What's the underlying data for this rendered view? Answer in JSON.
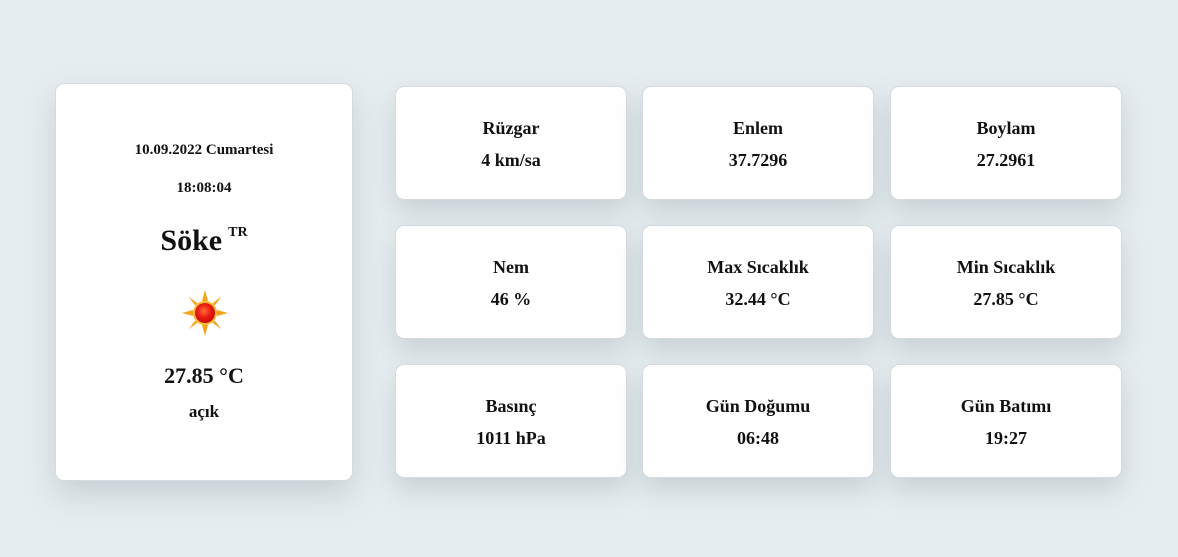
{
  "current": {
    "date": "10.09.2022 Cumartesi",
    "time": "18:08:04",
    "city": "Söke",
    "country": "TR",
    "icon": "sun-icon",
    "temperature": "27.85 °C",
    "description": "açık"
  },
  "details": [
    {
      "label": "Rüzgar",
      "value": "4 km/sa"
    },
    {
      "label": "Enlem",
      "value": "37.7296"
    },
    {
      "label": "Boylam",
      "value": "27.2961"
    },
    {
      "label": "Nem",
      "value": "46 %"
    },
    {
      "label": "Max Sıcaklık",
      "value": "32.44 °C"
    },
    {
      "label": "Min Sıcaklık",
      "value": "27.85 °C"
    },
    {
      "label": "Basınç",
      "value": "1011 hPa"
    },
    {
      "label": "Gün Doğumu",
      "value": "06:48"
    },
    {
      "label": "Gün Batımı",
      "value": "19:27"
    }
  ],
  "colors": {
    "background": "#e6edf0",
    "card": "#ffffff",
    "sun_core": "#e8180c",
    "sun_rays": "#f7a21b"
  }
}
